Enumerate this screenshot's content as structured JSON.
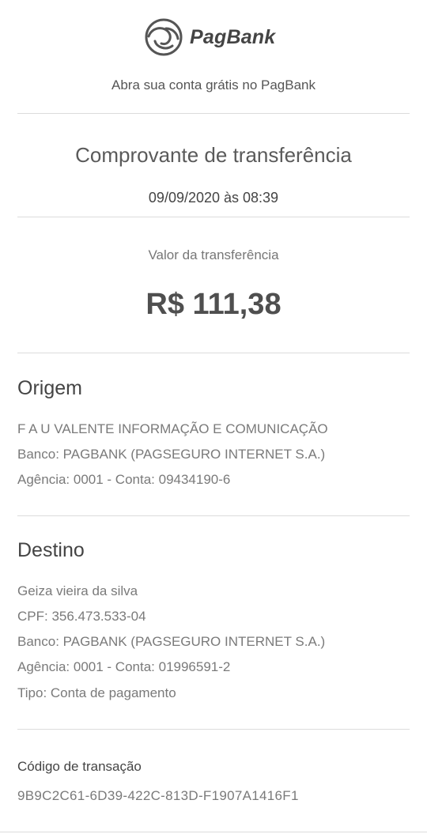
{
  "brand": {
    "name": "PagBank",
    "logo_icon": "pagbank-swirl-icon",
    "tagline": "Abra sua conta grátis no PagBank"
  },
  "receipt": {
    "title": "Comprovante de transferência",
    "datetime": "09/09/2020 às 08:39",
    "value_label": "Valor da transferência",
    "value": "R$ 111,38"
  },
  "origin": {
    "heading": "Origem",
    "name": "F A U VALENTE INFORMAÇÃO E COMUNICAÇÃO",
    "bank": "Banco: PAGBANK (PAGSEGURO INTERNET S.A.)",
    "account": "Agência: 0001 - Conta: 09434190-6"
  },
  "destination": {
    "heading": "Destino",
    "name": "Geiza vieira da silva",
    "cpf": "CPF: 356.473.533-04",
    "bank": "Banco: PAGBANK (PAGSEGURO INTERNET S.A.)",
    "account": "Agência: 0001 - Conta: 01996591-2",
    "type": "Tipo: Conta de pagamento"
  },
  "transaction": {
    "label": "Código de transação",
    "code": "9B9C2C61-6D39-422C-813D-F1907A1416F1"
  },
  "colors": {
    "text_dark": "#444444",
    "text_muted": "#7a7a7a",
    "divider": "#dcdcdc",
    "background": "#ffffff"
  }
}
